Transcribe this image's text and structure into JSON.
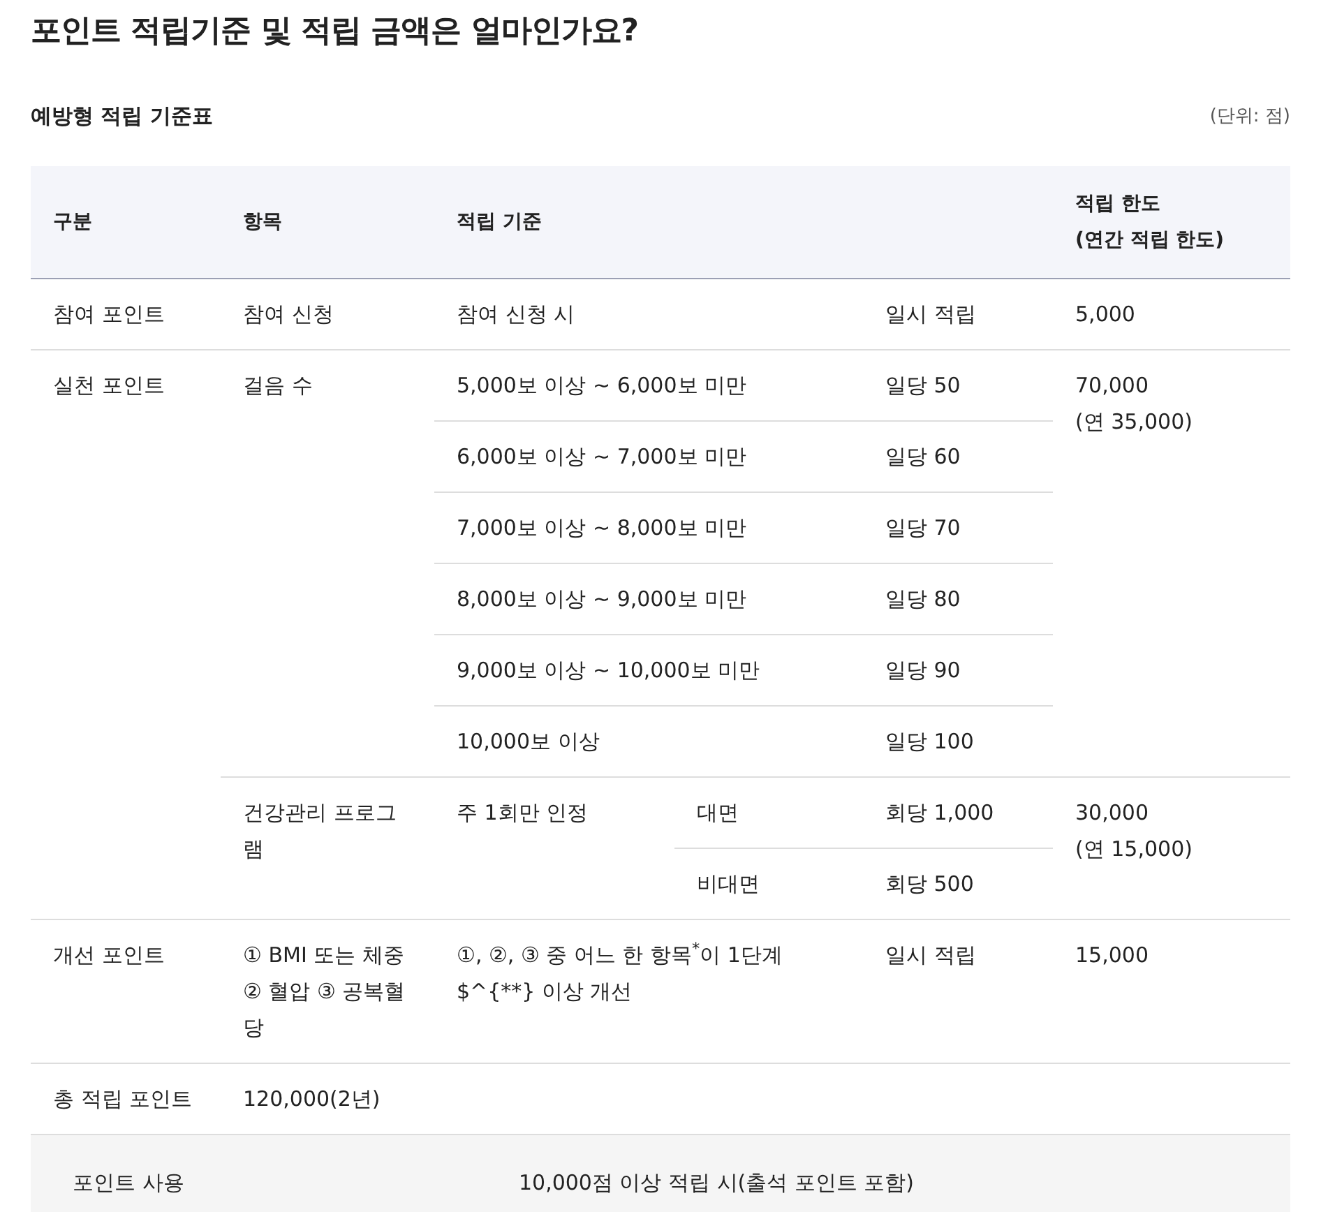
{
  "title": "포인트 적립기준 및 적립 금액은 얼마인가요?",
  "table_title": "예방형 적립 기준표",
  "unit": "(단위: 점)",
  "columns": [
    {
      "lines": [
        "구분"
      ]
    },
    {
      "lines": [
        "항목"
      ]
    },
    {
      "lines": [
        "적립 기준"
      ]
    },
    {
      "lines": [
        "적립 한도",
        "(연간 적립 한도)"
      ]
    }
  ],
  "groups": [
    {
      "category": "참여 포인트",
      "items": [
        {
          "item": "참여 신청",
          "criteria": [
            {
              "condition": "참여 신청 시",
              "amount": "일시 적립"
            }
          ],
          "limit": [
            "5,000"
          ]
        }
      ]
    },
    {
      "category": "실천 포인트",
      "items": [
        {
          "item": "걸음 수",
          "criteria": [
            {
              "condition": "5,000보 이상 ~ 6,000보 미만",
              "amount": "일당 50"
            },
            {
              "condition": "6,000보 이상 ~ 7,000보 미만",
              "amount": "일당 60"
            },
            {
              "condition": "7,000보 이상 ~ 8,000보 미만",
              "amount": "일당 70"
            },
            {
              "condition": "8,000보 이상 ~ 9,000보 미만",
              "amount": "일당 80"
            },
            {
              "condition": "9,000보 이상 ~ 10,000보 미만",
              "amount": "일당 90"
            },
            {
              "condition": "10,000보 이상",
              "amount": "일당 100"
            }
          ],
          "limit": [
            "70,000",
            "(연 35,000)"
          ]
        },
        {
          "item": "건강관리 프로그램",
          "note": "주 1회만 인정",
          "criteria": [
            {
              "condition": "대면",
              "amount": "회당 1,000"
            },
            {
              "condition": "비대면",
              "amount": "회당 500"
            }
          ],
          "limit": [
            "30,000",
            "(연 15,000)"
          ]
        }
      ]
    },
    {
      "category": "개선 포인트",
      "items": [
        {
          "item": "① BMI 또는 체중 ② 혈압 ③ 공복혈당",
          "criteria": [
            {
              "condition": "①, ②, ③ 중 어느 한 항목$^{*}$이 1단계$^{**} 이상 개선",
              "amount": "일시 적립"
            }
          ],
          "limit": [
            "15,000"
          ]
        }
      ]
    },
    {
      "category": "총 적립 포인트",
      "total": "120,000(2년)"
    }
  ],
  "footer": {
    "label": "포인트 사용",
    "value": "10,000점 이상 적립 시(출석 포인트 포함)"
  }
}
